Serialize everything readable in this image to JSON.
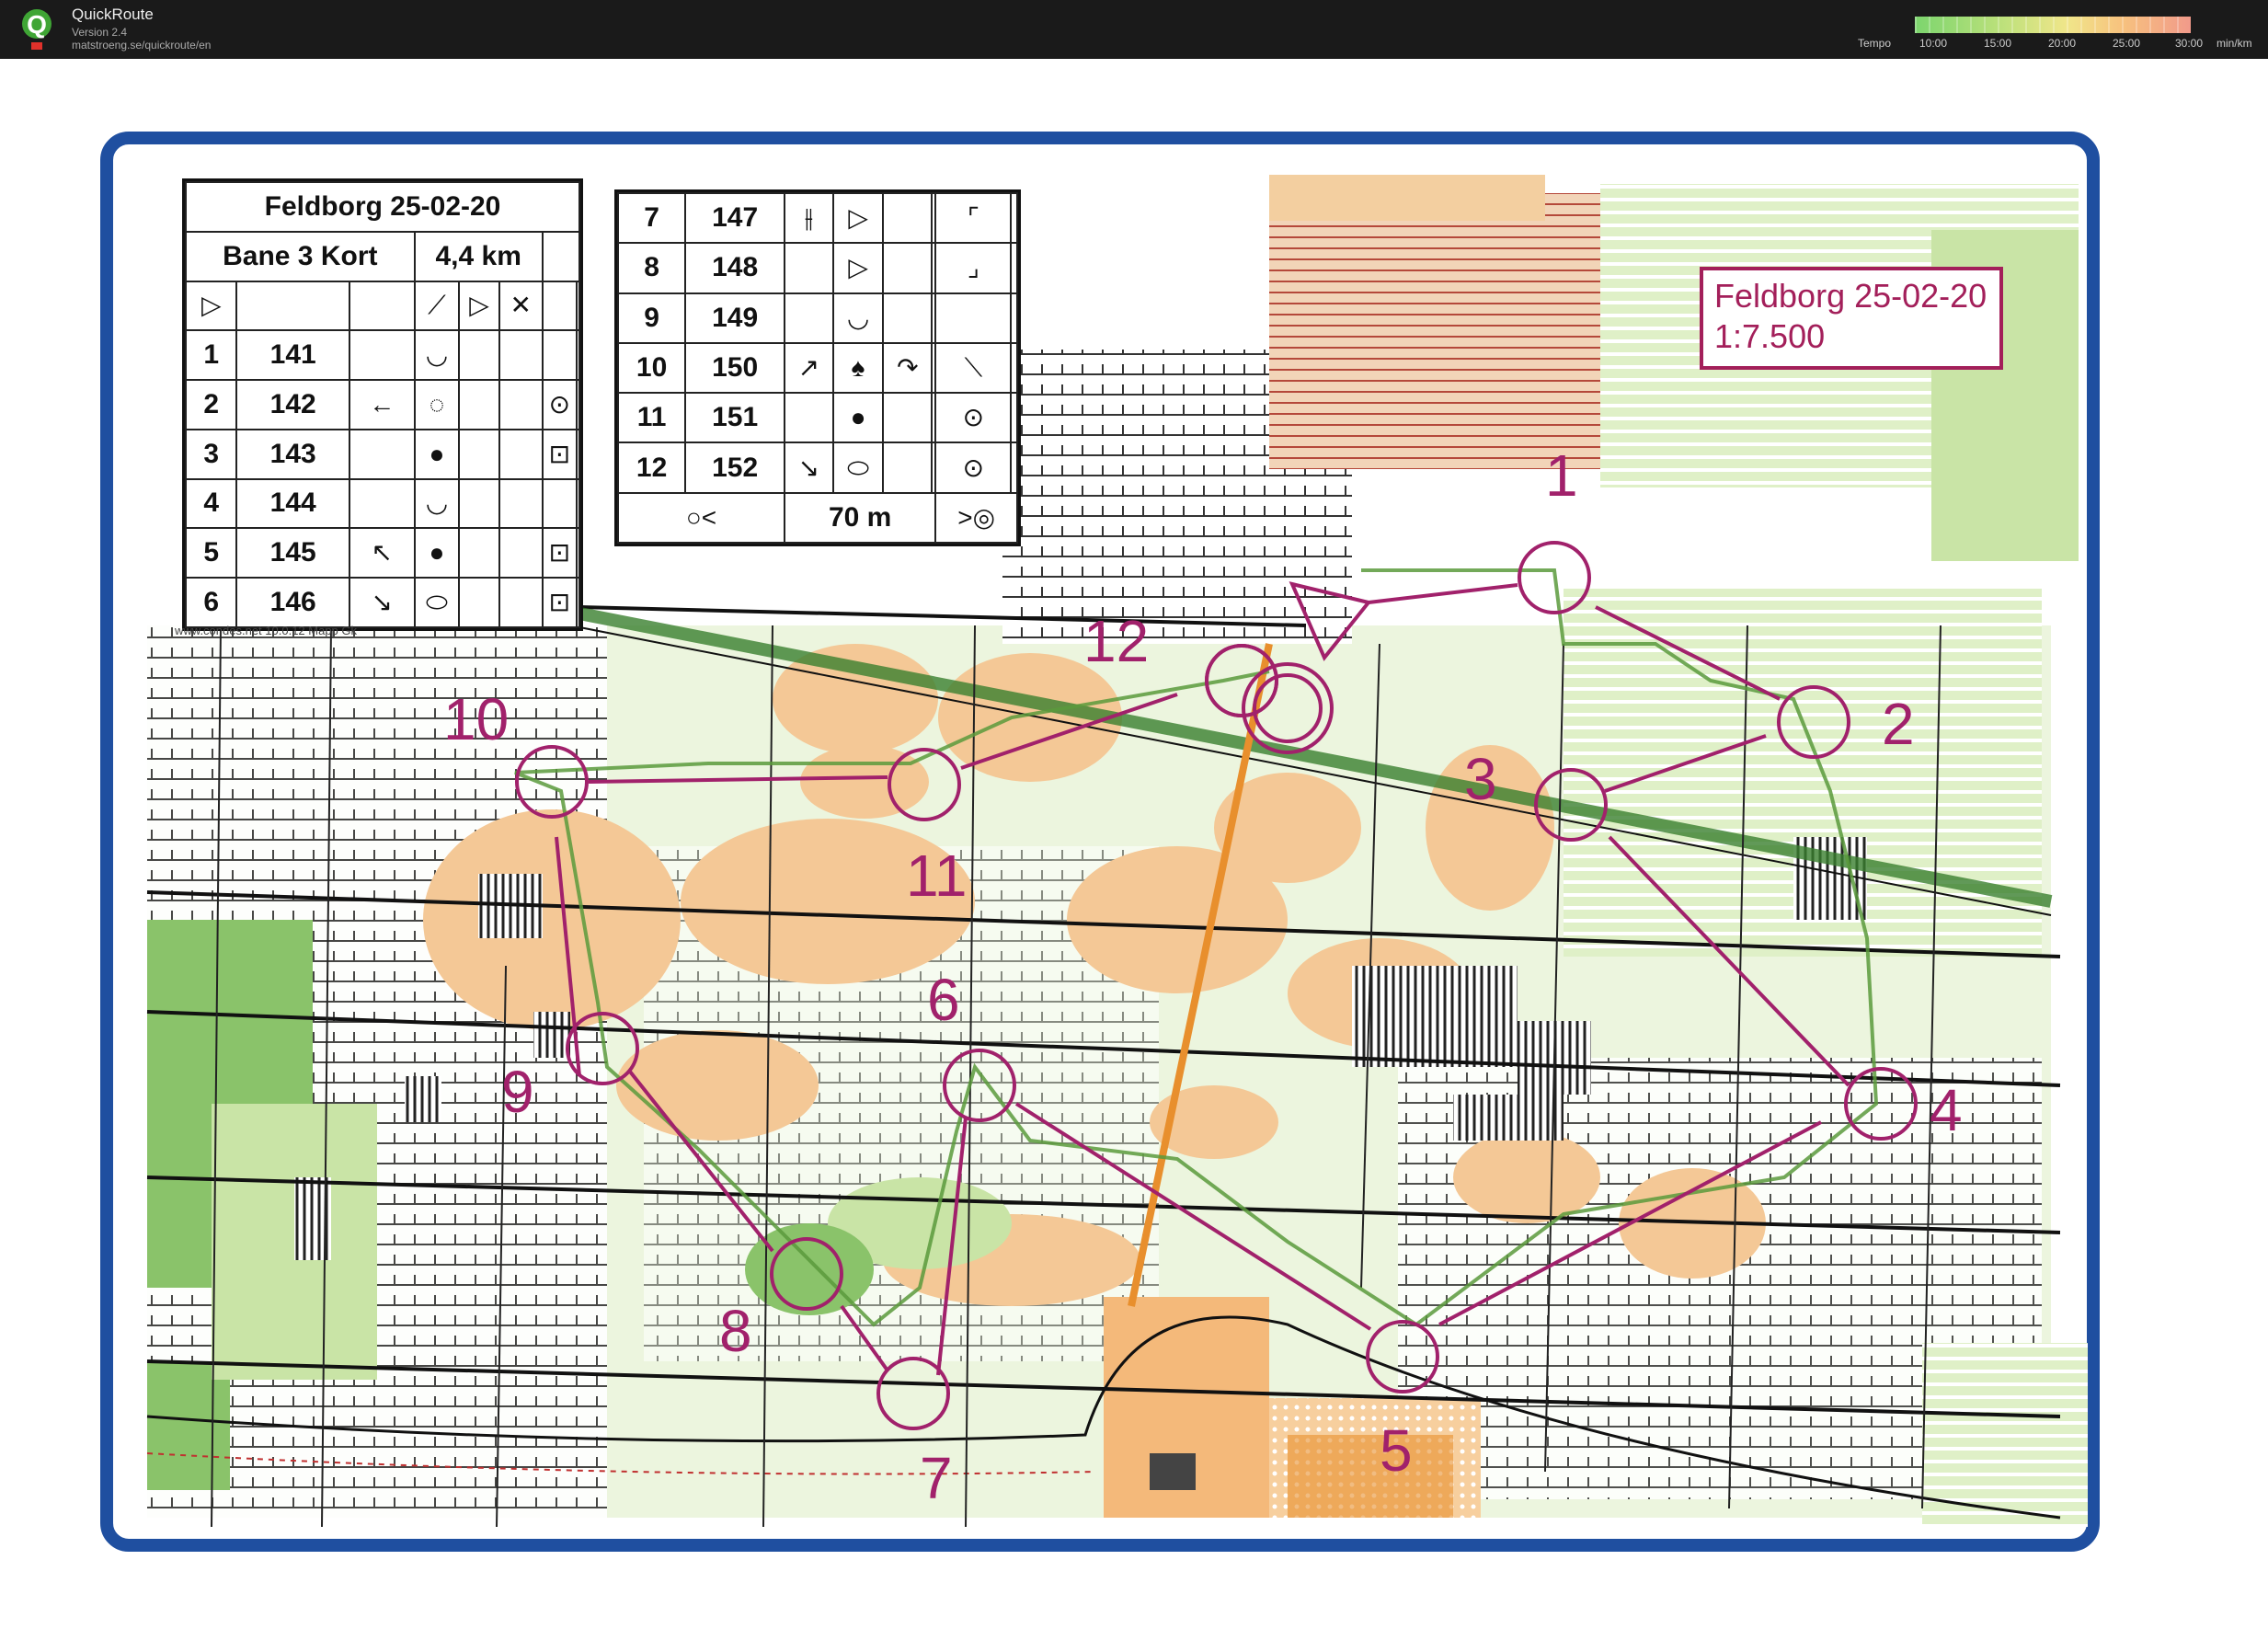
{
  "app": {
    "name": "QuickRoute",
    "version": "Version 2.4",
    "url": "matstroeng.se/quickroute/en"
  },
  "legend": {
    "title": "Tempo",
    "ticks": [
      "10:00",
      "15:00",
      "20:00",
      "25:00",
      "30:00"
    ],
    "unit": "min/km"
  },
  "course": {
    "title": "Feldborg 25-02-20",
    "course_name": "Bane 3 Kort",
    "length": "4,4 km",
    "scale": "1:7.500",
    "finish_distance": "70 m",
    "credit": "www.condes.net 10.0.12 Mapp Gk",
    "controls": [
      {
        "n": "1",
        "code": "141"
      },
      {
        "n": "2",
        "code": "142"
      },
      {
        "n": "3",
        "code": "143"
      },
      {
        "n": "4",
        "code": "144"
      },
      {
        "n": "5",
        "code": "145"
      },
      {
        "n": "6",
        "code": "146"
      },
      {
        "n": "7",
        "code": "147"
      },
      {
        "n": "8",
        "code": "148"
      },
      {
        "n": "9",
        "code": "149"
      },
      {
        "n": "10",
        "code": "150"
      },
      {
        "n": "11",
        "code": "151"
      },
      {
        "n": "12",
        "code": "152"
      }
    ],
    "map_labels": [
      "1",
      "2",
      "3",
      "4",
      "5",
      "6",
      "7",
      "8",
      "9",
      "10",
      "11",
      "12"
    ]
  },
  "colors": {
    "course": "#a1216b",
    "route": "#5b9a3c",
    "open": "#f4c896",
    "forest": "#c9e4a6",
    "green": "#8ac36a",
    "border": "#1f4fa0"
  }
}
